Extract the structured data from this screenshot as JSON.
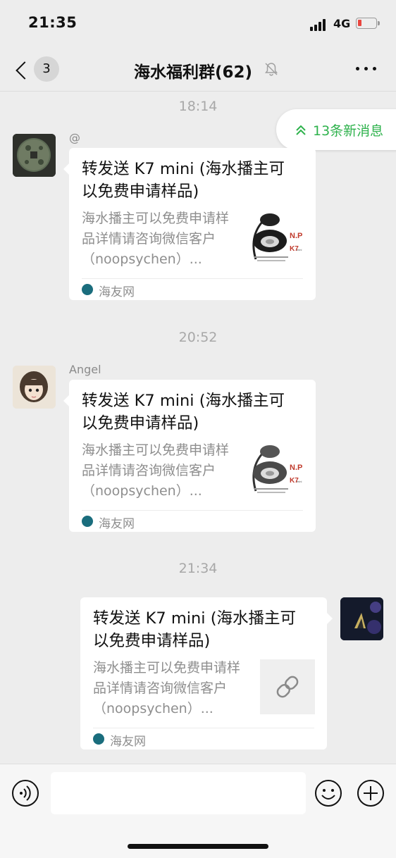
{
  "status_bar": {
    "time": "21:35",
    "network": "4G"
  },
  "nav": {
    "unread_count": "3",
    "title": "海水福利群(62)"
  },
  "new_messages": {
    "label": "13条新消息"
  },
  "messages": [
    {
      "time": "18:14",
      "sender": "@",
      "card": {
        "title": "转发送 K7 mini (海水播主可以免费申请样品)",
        "description": "海水播主可以免费申请样品详情请咨询微信客户（noopsychen）...",
        "source": "海友网"
      }
    },
    {
      "time": "20:52",
      "sender": "Angel",
      "card": {
        "title": "转发送 K7 mini (海水播主可以免费申请样品)",
        "description": "海水播主可以免费申请样品详情请咨询微信客户（noopsychen）...",
        "source": "海友网"
      }
    },
    {
      "time": "21:34",
      "sender": "",
      "card": {
        "title": "转发送 K7 mini (海水播主可以免费申请样品)",
        "description": "海水播主可以免费申请样品详情请咨询微信客户（noopsychen）...",
        "source": "海友网"
      }
    }
  ],
  "product_image": {
    "brand": "N.P",
    "model": "K7",
    "model_sub": "mini"
  },
  "icons": {
    "back": "chevron-left-icon",
    "mute": "bell-off-icon",
    "more": "more-dots-icon",
    "new_messages": "double-chevron-up-icon",
    "link": "link-icon",
    "voice": "voice-icon",
    "emoji": "emoji-icon",
    "plus": "plus-icon"
  },
  "colors": {
    "accent_green": "#2eb24c",
    "background": "#ededed"
  }
}
